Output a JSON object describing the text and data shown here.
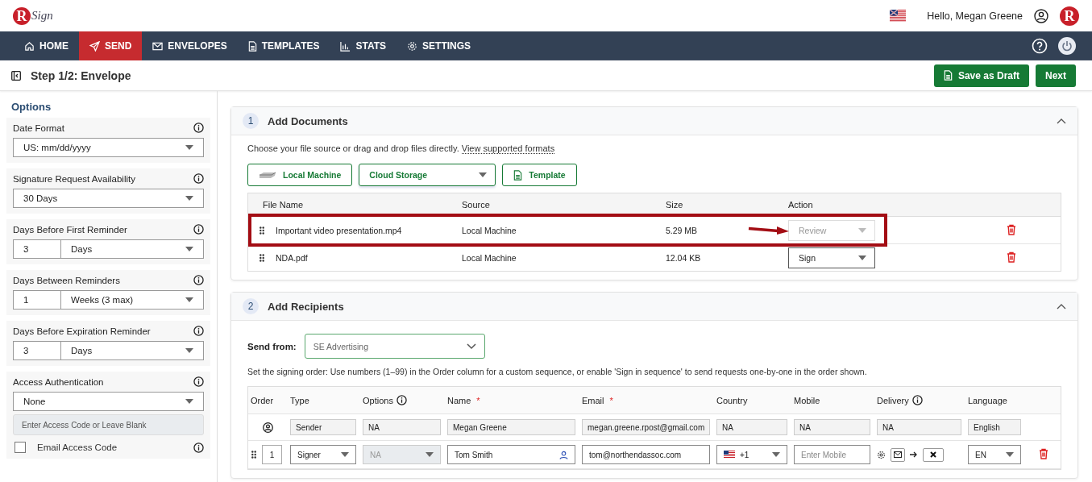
{
  "header": {
    "logo_letter": "R",
    "logo_word": "Sign",
    "greeting": "Hello, Megan Greene",
    "avatar_letter": "R"
  },
  "nav": [
    {
      "label": "HOME",
      "selected": false
    },
    {
      "label": "SEND",
      "selected": true
    },
    {
      "label": "ENVELOPES",
      "selected": false
    },
    {
      "label": "TEMPLATES",
      "selected": false
    },
    {
      "label": "STATS",
      "selected": false
    },
    {
      "label": "SETTINGS",
      "selected": false
    }
  ],
  "step_title": "Step 1/2: Envelope",
  "actions": [
    {
      "label": "Save as Draft",
      "kind": "draft"
    },
    {
      "label": "Next",
      "kind": "next"
    }
  ],
  "options": {
    "title": "Options",
    "groups": [
      {
        "kind": "select",
        "label": "Date Format",
        "value": "US: mm/dd/yyyy"
      },
      {
        "kind": "select",
        "label": "Signature Request Availability",
        "value": "30 Days"
      },
      {
        "kind": "number_unit",
        "label": "Days Before First Reminder",
        "number": "3",
        "unit": "Days"
      },
      {
        "kind": "number_unit",
        "label": "Days Between Reminders",
        "number": "1",
        "unit": "Weeks (3 max)"
      },
      {
        "kind": "number_unit",
        "label": "Days Before Expiration Reminder",
        "number": "3",
        "unit": "Days"
      },
      {
        "kind": "access",
        "label": "Access Authentication",
        "value": "None",
        "placeholder": "Enter Access Code or Leave Blank",
        "checkbox_label": "Email Access Code",
        "checked": false
      }
    ]
  },
  "documents": {
    "step": "1",
    "title": "Add Documents",
    "intro": "Choose your file source or drag and drop files directly.",
    "link": "View supported formats",
    "sources": [
      {
        "kind": "local",
        "label": "Local Machine"
      },
      {
        "kind": "select",
        "label": "Cloud Storage"
      },
      {
        "kind": "template",
        "label": "Template"
      }
    ],
    "columns": [
      "File Name",
      "Source",
      "Size",
      "Action"
    ],
    "rows": [
      {
        "file": "Important video presentation.mp4",
        "source": "Local Machine",
        "size": "5.29 MB",
        "action": "Review",
        "disabled": true,
        "highlighted": true
      },
      {
        "file": "NDA.pdf",
        "source": "Local Machine",
        "size": "12.04 KB",
        "action": "Sign",
        "disabled": false,
        "highlighted": false
      }
    ]
  },
  "recipients": {
    "step": "2",
    "title": "Add Recipients",
    "send_from_label": "Send from:",
    "send_from": "SE Advertising",
    "note": "Set the signing order: Use numbers (1–99) in the Order column for a custom sequence, or enable 'Sign in sequence' to send requests one-by-one in the order shown.",
    "columns": [
      {
        "label": "Order",
        "info": false
      },
      {
        "label": "Type",
        "info": false
      },
      {
        "label": "Options",
        "info": true
      },
      {
        "label": "Name",
        "info": false,
        "required_mark": "*"
      },
      {
        "label": "Email",
        "info": false,
        "required_mark": "*"
      },
      {
        "label": "Country",
        "info": false
      },
      {
        "label": "Mobile",
        "info": false
      },
      {
        "label": "Delivery",
        "info": true
      },
      {
        "label": "Language",
        "info": false
      }
    ],
    "rows": [
      {
        "kind": "sender",
        "type": "Sender",
        "options": "NA",
        "name": "Megan Greene",
        "email": "megan.greene.rpost@gmail.com",
        "country": "NA",
        "mobile": "NA",
        "delivery": "NA",
        "language": "English"
      },
      {
        "kind": "signer",
        "order": "1",
        "type": "Signer",
        "options": "NA",
        "name": "Tom Smith",
        "email": "tom@northendassoc.com",
        "country_code": "+1",
        "mobile_placeholder": "Enter Mobile",
        "language": "EN"
      }
    ]
  }
}
